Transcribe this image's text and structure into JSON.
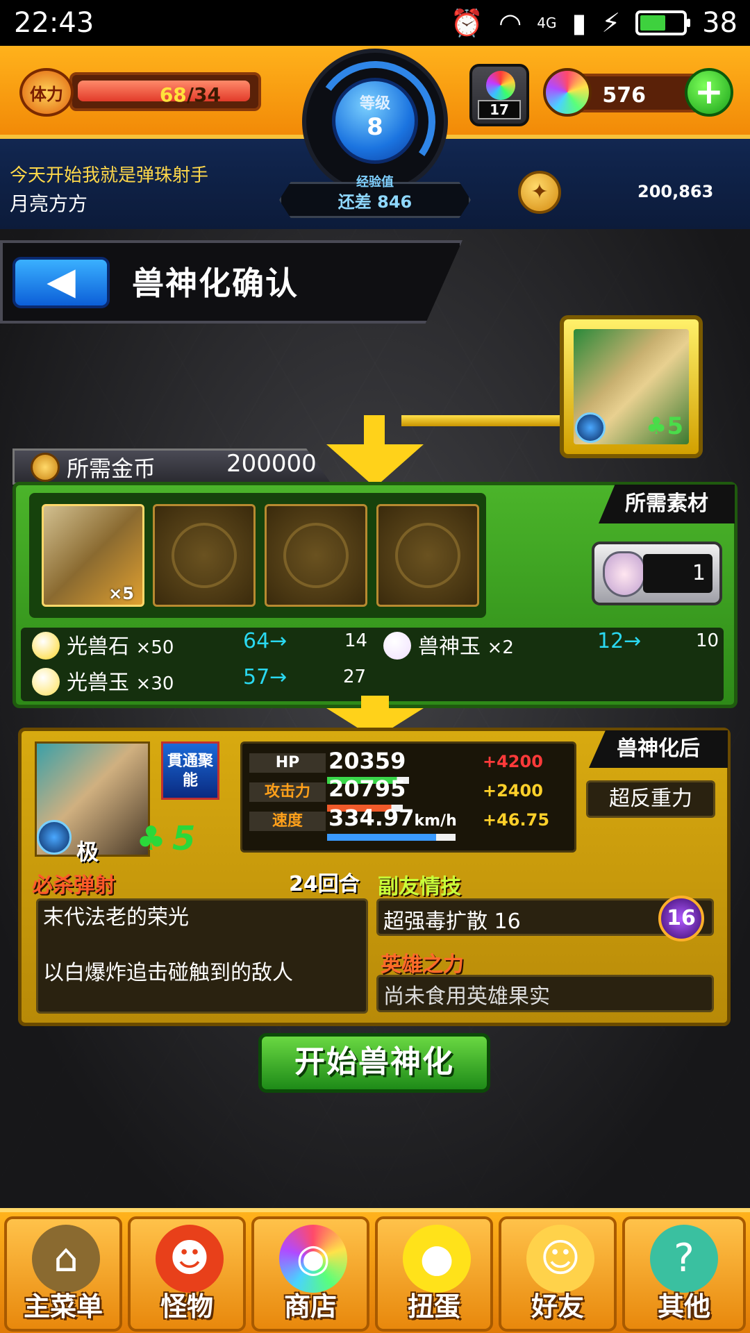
{
  "status_bar": {
    "time": "22:43",
    "battery": "38",
    "network": "4G"
  },
  "hud": {
    "stamina_label": "体力",
    "stamina_current": "68",
    "stamina_max": "/34",
    "level_label": "等级",
    "level": "8",
    "exp_label": "经验值",
    "exp_remaining": "还差 846",
    "tower_count": "17",
    "gems": "576",
    "plus": "+",
    "motto": "今天开始我就是弹珠射手",
    "username": "月亮方方",
    "coins": "200,863"
  },
  "page": {
    "title": "兽神化确认",
    "back": "◀"
  },
  "cost": {
    "label": "所需金币",
    "value": "200000"
  },
  "materials": {
    "tag": "所需素材",
    "filled_slot_qty": "×5",
    "tower_req": "1",
    "stones": [
      {
        "name": "光兽石",
        "qty": "×50",
        "have": "64→",
        "after": "14",
        "color": "#ffd82a"
      },
      {
        "name": "兽神玉",
        "qty": "×2",
        "have": "12→",
        "after": "10",
        "color": "#f0e0ff"
      },
      {
        "name": "光兽玉",
        "qty": "×30",
        "have": "57→",
        "after": "27",
        "color": "#ffe25a"
      }
    ]
  },
  "after": {
    "tag": "兽神化后",
    "rank": "极",
    "clover": "♣",
    "stars": "5",
    "ability": "貫通聚能",
    "stats": [
      {
        "label": "HP",
        "value": "20359",
        "unit": "",
        "bonus": "+4200",
        "bonus_color": "#ff3a3a",
        "bar_color": "#3ad84a",
        "fill": 0.56
      },
      {
        "label": "攻击力",
        "value": "20795",
        "unit": "",
        "bonus": "+2400",
        "bonus_color": "#ffd02a",
        "bar_color": "#f05a2a",
        "fill": 0.52
      },
      {
        "label": "速度",
        "value": "334.97",
        "unit": "km/h",
        "bonus": "+46.75",
        "bonus_color": "#ffd02a",
        "bar_color": "#3a9aff",
        "fill": 0.88
      }
    ],
    "ability_name": "超反重力",
    "strike_shot_head": "必杀弹射",
    "turns": "24回合",
    "strike_shot_name": "末代法老的荣光",
    "strike_shot_desc": "以白爆炸追击碰触到的敌人",
    "friend_head": "副友情技",
    "friend_skill": "超强毒扩散 16",
    "friend_badge": "16",
    "hero_head": "英雄之力",
    "hero_text": "尚未食用英雄果实"
  },
  "start_button": "开始兽神化",
  "nav": [
    {
      "label": "主菜单",
      "icon": "⌂"
    },
    {
      "label": "怪物",
      "icon": "☻"
    },
    {
      "label": "商店",
      "icon": "◉"
    },
    {
      "label": "扭蛋",
      "icon": "●"
    },
    {
      "label": "好友",
      "icon": "☺"
    },
    {
      "label": "其他",
      "icon": "?"
    }
  ],
  "colors": {
    "accent_orange": "#f28a07",
    "panel_green": "#2e8a18",
    "panel_gold": "#b88a08"
  }
}
